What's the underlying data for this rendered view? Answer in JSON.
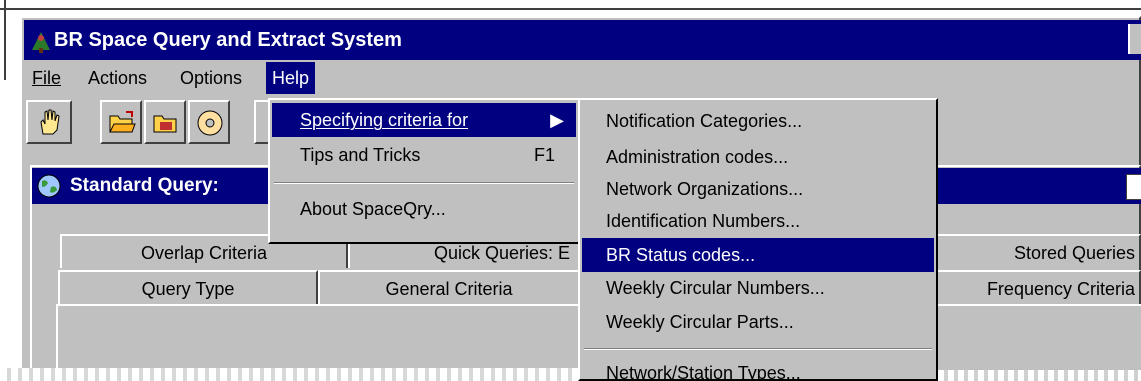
{
  "window": {
    "title": "BR Space Query and Extract System"
  },
  "menubar": {
    "file": "File",
    "actions": "Actions",
    "options": "Options",
    "help": "Help"
  },
  "help_menu": {
    "item1": "Specifying criteria for",
    "item2": "Tips and Tricks",
    "item2_shortcut": "F1",
    "item3": "About SpaceQry..."
  },
  "submenu": {
    "items": [
      "Notification Categories...",
      "Administration codes...",
      "Network Organizations...",
      "Identification Numbers...",
      "BR Status codes...",
      "Weekly Circular Numbers...",
      "Weekly Circular Parts...",
      "Network/Station Types..."
    ],
    "selected": "BR Status codes..."
  },
  "inner_window": {
    "title": "Standard Query:"
  },
  "tabs_row1": {
    "overlap": "Overlap Criteria",
    "quick": "Quick Queries: E",
    "stored": "Stored Queries"
  },
  "tabs_row2": {
    "query_type": "Query Type",
    "general": "General Criteria",
    "frequency": "Frequency Criteria"
  },
  "colors": {
    "titlebar": "#000080",
    "face": "#c0c0c0",
    "highlight": "#000080"
  }
}
